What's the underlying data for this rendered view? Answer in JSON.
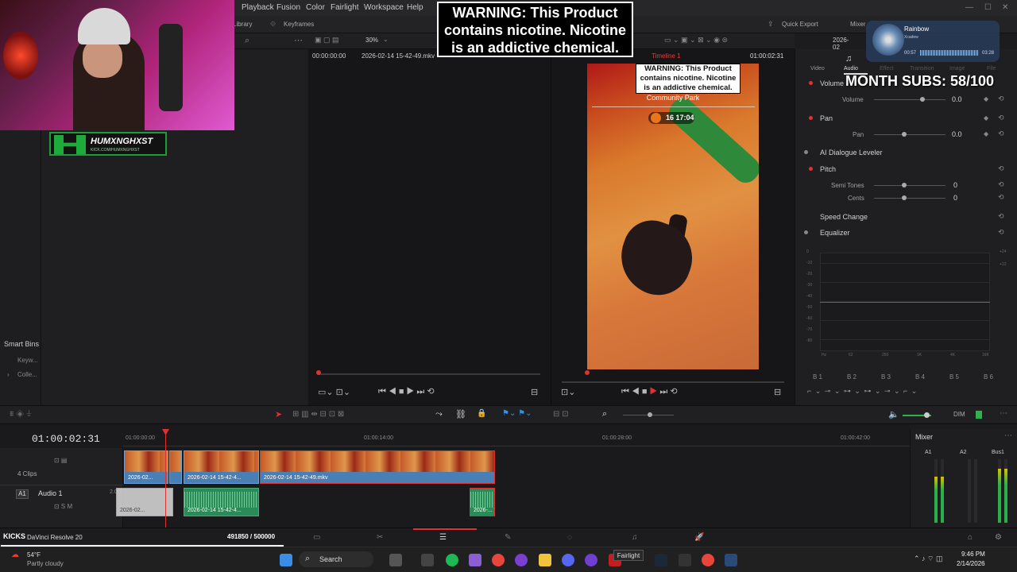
{
  "menu": {
    "items": [
      "Playback",
      "Fusion",
      "Color",
      "Fairlight",
      "Workspace",
      "Help"
    ]
  },
  "toolbar": {
    "library": "Library",
    "keyframes": "Keyframes",
    "zoom": "30%",
    "quick_export": "Quick Export",
    "mixer": "Mixer",
    "date_tab": "2026-02"
  },
  "overlay": {
    "warning": "WARNING: This Product contains nicotine. Nicotine is an addictive chemical.",
    "subs": "MONTH SUBS: 58/100",
    "streamer_name": "HUMXNGHXST",
    "streamer_url": "KICK.COM/HUMXNGHXST"
  },
  "music": {
    "title": "Rainbow",
    "artist": "Xcadew",
    "elapsed": "00:57",
    "total": "03:28"
  },
  "source_viewer": {
    "timecode": "00:00:00:00",
    "clip_name": "2026-02-14 15-42-49.mkv"
  },
  "timeline_viewer": {
    "timeline_name": "Timeline 1",
    "timecode": "01:00:02:31",
    "video_warning": "WARNING: This Product contains nicotine. Nicotine is an addictive chemical.",
    "location": "Community Park",
    "time_badge": "16 17:04"
  },
  "inspector": {
    "tabs": [
      "Video",
      "Audio",
      "Effect",
      "Transition",
      "Image",
      "File"
    ],
    "volume_section": "Volume",
    "volume_label": "Volume",
    "volume_value": "0.0",
    "pan_section": "Pan",
    "pan_label": "Pan",
    "pan_value": "0.0",
    "ai_leveler": "AI Dialogue Leveler",
    "pitch_section": "Pitch",
    "semitones_label": "Semi Tones",
    "semitones_value": "0",
    "cents_label": "Cents",
    "cents_value": "0",
    "speed_change": "Speed Change",
    "equalizer": "Equalizer",
    "eq_y_labels": [
      "+24",
      "+12",
      "0",
      "-10",
      "-20",
      "-30",
      "-40",
      "-50",
      "-60",
      "-70",
      "-80"
    ],
    "eq_x_labels": [
      "Hz",
      "62",
      "250",
      "1K",
      "4K",
      "16K"
    ],
    "bands": [
      "B 1",
      "B 2",
      "B 3",
      "B 4",
      "B 5",
      "B 6"
    ]
  },
  "left_panel": {
    "smart_bins": "Smart Bins",
    "keywords": "Keyw...",
    "collections": "Colle..."
  },
  "timeline": {
    "timecode": "01:00:02:31",
    "ruler": [
      "01:00:00:00",
      "01:00:14:00",
      "01:00:28:00",
      "01:00:42:00"
    ],
    "clip_count": "4 Clips",
    "audio_track_id": "A1",
    "audio_track_name": "Audio 1",
    "audio_track_level": "2.0",
    "dim": "DIM",
    "video_clips": [
      "2026-02...",
      "2026-02-14 15-42-4...",
      "2026-02-14 15-42-49.mkv"
    ],
    "audio_clips": [
      "2026-02...",
      "2026-02-14 15-42-4...",
      "2026-..."
    ]
  },
  "mixer": {
    "title": "Mixer",
    "channels": [
      "A1",
      "A2",
      "Bus1"
    ],
    "levels": [
      0.72,
      0.0,
      0.85
    ]
  },
  "status": {
    "app_name": "DaVinci Resolve 20",
    "kicks_label": "KICKS",
    "kicks_count": "491850 / 500000",
    "kicks_progress": 0.9837,
    "weather_temp": "54°F",
    "weather_desc": "Partly cloudy",
    "search": "Search",
    "tooltip": "Fairlight",
    "time": "9:46 PM",
    "date": "2/14/2026"
  }
}
